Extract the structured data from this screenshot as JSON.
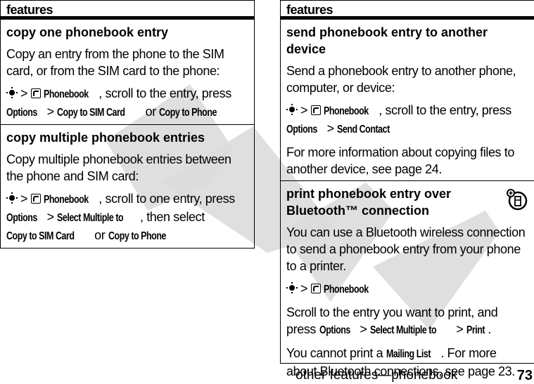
{
  "watermark": "DRAFT",
  "left_table": {
    "header": "features",
    "rows": [
      {
        "title": "copy one phonebook entry",
        "intro": "Copy an entry from the phone to the SIM card, or from the SIM card to the phone:",
        "path": {
          "nav_icon": "nav-key-icon",
          "sep": ">",
          "app_icon": "phonebook-icon",
          "app": "Phonebook",
          "text1": ", scroll to the entry, press",
          "k1": "Options",
          "sep2": ">",
          "k2": "Copy to SIM Card",
          "or": "or",
          "k3": "Copy to Phone"
        }
      },
      {
        "title": "copy multiple phonebook entries",
        "intro": "Copy multiple phonebook entries between the phone and SIM card:",
        "path": {
          "app": "Phonebook",
          "text1": ", scroll to one entry, press",
          "k1": "Options",
          "sep": ">",
          "k2": "Select Multiple to",
          "text2": ", then select",
          "k3": "Copy to SIM Card",
          "or": "or",
          "k4": "Copy to Phone"
        }
      }
    ]
  },
  "right_table": {
    "header": "features",
    "rows": [
      {
        "title": "send phonebook entry to another device",
        "intro": "Send a phonebook entry to another phone, computer, or device:",
        "path": {
          "app": "Phonebook",
          "text1": ", scroll to the entry, press",
          "k1": "Options",
          "sep": ">",
          "k2": "Send Contact"
        },
        "note": "For more information about copying files to another device, see page 24."
      },
      {
        "title": "print phonebook entry over Bluetooth™ connection",
        "feature_icon": "network-feature-icon",
        "intro": "You can use a Bluetooth wireless connection to send a phonebook entry from your phone to a printer.",
        "path": {
          "app": "Phonebook",
          "sep": ">"
        },
        "steps": {
          "text1": "Scroll to the entry you want to print, and press",
          "k1": "Options",
          "sep": ">",
          "k2": "Select Multiple to",
          "k3": "Print",
          "end": "."
        },
        "note": {
          "text1": "You cannot print a",
          "k1": "Mailing List",
          "text2": ". For more about Bluetooth connections, see page 23."
        }
      }
    ]
  },
  "footer": {
    "section": "other features—phonebook",
    "page": "73"
  }
}
